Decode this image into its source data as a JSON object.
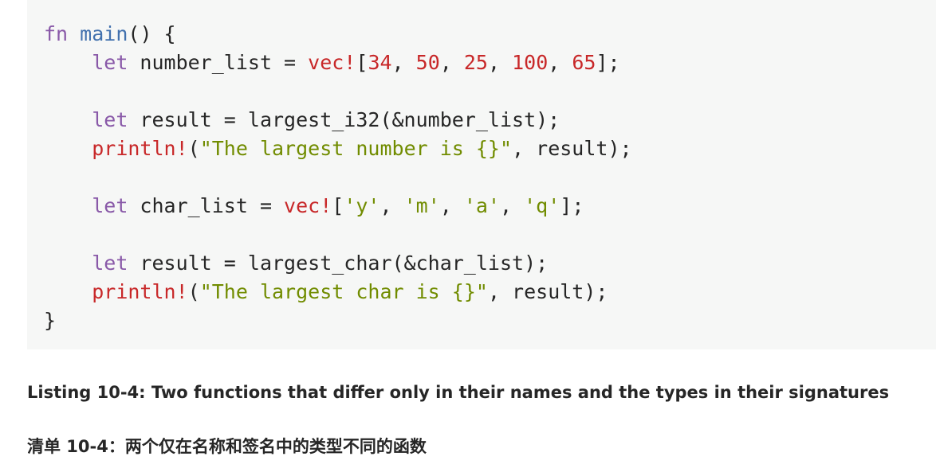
{
  "code": {
    "lines": [
      [
        {
          "t": "fn",
          "c": "kw"
        },
        {
          "t": " ",
          "c": "plain"
        },
        {
          "t": "main",
          "c": "fn"
        },
        {
          "t": "() {",
          "c": "plain"
        }
      ],
      [
        {
          "t": "    ",
          "c": "plain"
        },
        {
          "t": "let",
          "c": "kw"
        },
        {
          "t": " number_list = ",
          "c": "plain"
        },
        {
          "t": "vec!",
          "c": "mac"
        },
        {
          "t": "[",
          "c": "plain"
        },
        {
          "t": "34",
          "c": "num"
        },
        {
          "t": ", ",
          "c": "plain"
        },
        {
          "t": "50",
          "c": "num"
        },
        {
          "t": ", ",
          "c": "plain"
        },
        {
          "t": "25",
          "c": "num"
        },
        {
          "t": ", ",
          "c": "plain"
        },
        {
          "t": "100",
          "c": "num"
        },
        {
          "t": ", ",
          "c": "plain"
        },
        {
          "t": "65",
          "c": "num"
        },
        {
          "t": "];",
          "c": "plain"
        }
      ],
      [],
      [
        {
          "t": "    ",
          "c": "plain"
        },
        {
          "t": "let",
          "c": "kw"
        },
        {
          "t": " result = largest_i32(&number_list);",
          "c": "plain"
        }
      ],
      [
        {
          "t": "    ",
          "c": "plain"
        },
        {
          "t": "println!",
          "c": "mac"
        },
        {
          "t": "(",
          "c": "plain"
        },
        {
          "t": "\"The largest number is {}\"",
          "c": "str"
        },
        {
          "t": ", result);",
          "c": "plain"
        }
      ],
      [],
      [
        {
          "t": "    ",
          "c": "plain"
        },
        {
          "t": "let",
          "c": "kw"
        },
        {
          "t": " char_list = ",
          "c": "plain"
        },
        {
          "t": "vec!",
          "c": "mac"
        },
        {
          "t": "[",
          "c": "plain"
        },
        {
          "t": "'y'",
          "c": "str"
        },
        {
          "t": ", ",
          "c": "plain"
        },
        {
          "t": "'m'",
          "c": "str"
        },
        {
          "t": ", ",
          "c": "plain"
        },
        {
          "t": "'a'",
          "c": "str"
        },
        {
          "t": ", ",
          "c": "plain"
        },
        {
          "t": "'q'",
          "c": "str"
        },
        {
          "t": "];",
          "c": "plain"
        }
      ],
      [],
      [
        {
          "t": "    ",
          "c": "plain"
        },
        {
          "t": "let",
          "c": "kw"
        },
        {
          "t": " result = largest_char(&char_list);",
          "c": "plain"
        }
      ],
      [
        {
          "t": "    ",
          "c": "plain"
        },
        {
          "t": "println!",
          "c": "mac"
        },
        {
          "t": "(",
          "c": "plain"
        },
        {
          "t": "\"The largest char is {}\"",
          "c": "str"
        },
        {
          "t": ", result);",
          "c": "plain"
        }
      ],
      [
        {
          "t": "}",
          "c": "plain"
        }
      ]
    ]
  },
  "caption": {
    "english": "Listing 10-4: Two functions that differ only in their names and the types in their signatures",
    "chinese": "清单 10-4：两个仅在名称和签名中的类型不同的函数"
  },
  "colors": {
    "code_background": "#f6f7f6",
    "keyword": "#8959a8",
    "function_name": "#4271ae",
    "macro_and_number": "#c82829",
    "string": "#718c00",
    "text": "#262626"
  }
}
